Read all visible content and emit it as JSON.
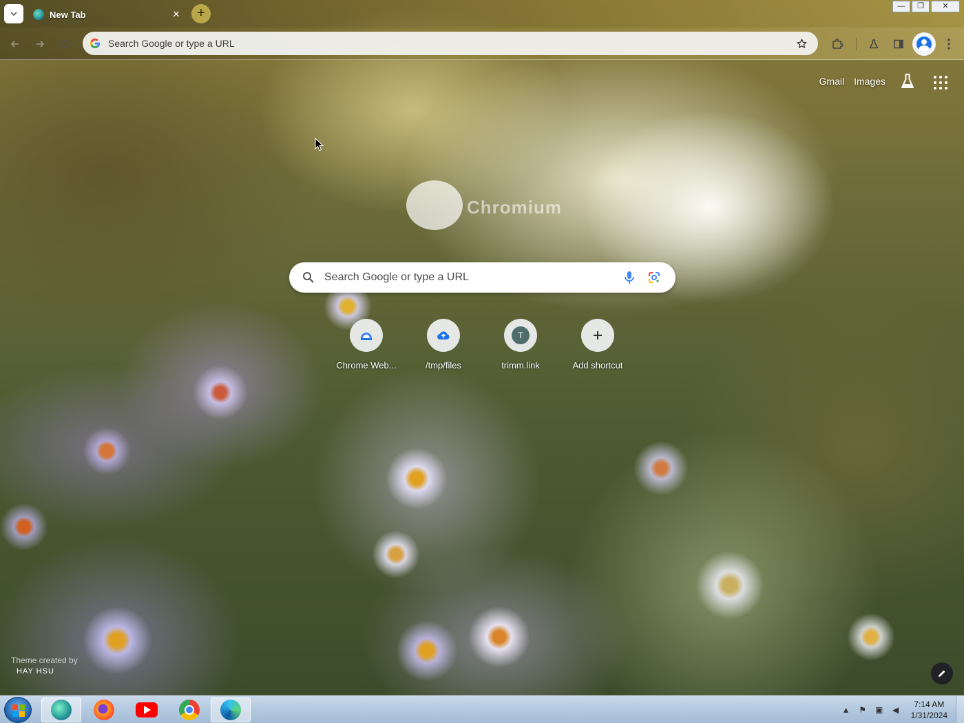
{
  "browser": {
    "tab": {
      "title": "New Tab",
      "close_glyph": "✕"
    },
    "new_tab_glyph": "+",
    "window_controls": {
      "minimize": "—",
      "restore": "❐",
      "close": "✕"
    },
    "omnibox": {
      "placeholder": "Search Google or type a URL"
    }
  },
  "ntp": {
    "links": {
      "gmail": "Gmail",
      "images": "Images"
    },
    "logo_text": "Chromium",
    "search": {
      "placeholder": "Search Google or type a URL"
    },
    "shortcuts": [
      {
        "label": "Chrome Web...",
        "icon": "chrome-web-store-icon"
      },
      {
        "label": "/tmp/files",
        "icon": "cloud-upload-icon"
      },
      {
        "label": "trimm.link",
        "icon": "letter-avatar",
        "letter": "T"
      },
      {
        "label": "Add shortcut",
        "icon": "plus-icon"
      }
    ],
    "theme_credit": {
      "label": "Theme created by",
      "author": "HAY HSU"
    }
  },
  "taskbar": {
    "clock": {
      "time": "7:14 AM",
      "date": "1/31/2024"
    }
  },
  "colors": {
    "accent": "#1a73e8",
    "taskbar": "#b5cae0"
  }
}
